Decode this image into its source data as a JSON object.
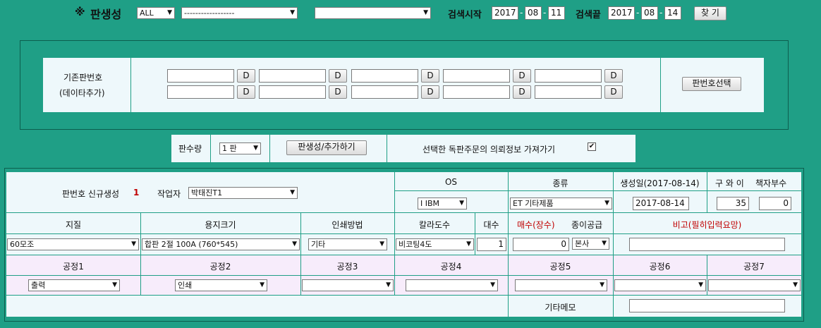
{
  "top": {
    "mark": "※",
    "title": "판생성",
    "filter_all": "ALL",
    "filter2": "------------------",
    "filter3": "",
    "start_label": "검색시작",
    "start_year": "2017",
    "start_month": "08",
    "start_day": "11",
    "end_label": "검색끝",
    "end_year": "2017",
    "end_month": "08",
    "end_day": "14",
    "find_button": "찾 기",
    "dash": "-"
  },
  "existing": {
    "label_line1": "기존판번호",
    "label_line2": "(데이타추가)",
    "d_label": "D",
    "select_button": "판번호선택"
  },
  "action": {
    "count_label": "판수량",
    "count_value": "1 판",
    "create_button": "판생성/추가하기",
    "fetch_label": "선택한 독판주문의 의뢰정보 가져가기",
    "fetch_checked": "true"
  },
  "form": {
    "new_label": "판번호 신규생성",
    "new_count": "1",
    "worker_label": "작업자",
    "worker_value": "박태진T1",
    "os_label": "OS",
    "os_value": "I IBM",
    "type_label": "종류",
    "type_value": "ET 기타제품",
    "created_label": "생성일(2017-08-14)",
    "created_value": "2017-08-14",
    "fold_label": "구 와 이",
    "copies_label": "책자부수",
    "fold_value": "35",
    "copies_value": "0",
    "paper_label": "지질",
    "paper_value": "60모조",
    "size_label": "용지크기",
    "size_value": "합판 2절 100A (760*545)",
    "print_label": "인쇄방법",
    "print_value": "기타",
    "color_label": "칼라도수",
    "color_value": "비코팅4도",
    "units_label": "대수",
    "units_value": "1",
    "sheets_label": "매수(장수)",
    "sheets_value": "0",
    "supply_label": "종이공급",
    "supply_value": "본사",
    "note_label": "비고(필히입력요망)",
    "note_value": "",
    "processes": [
      {
        "label": "공정1",
        "value": "출력"
      },
      {
        "label": "공정2",
        "value": "인쇄"
      },
      {
        "label": "공정3",
        "value": ""
      },
      {
        "label": "공정4",
        "value": ""
      },
      {
        "label": "공정5",
        "value": ""
      },
      {
        "label": "공정6",
        "value": ""
      },
      {
        "label": "공정7",
        "value": ""
      }
    ],
    "memo_label": "기타메모",
    "memo_value": ""
  },
  "colors": {
    "background": "#1f9f86",
    "panel": "#eef8fb",
    "process_row": "#f7ecfb",
    "accent_red": "#c00000"
  }
}
